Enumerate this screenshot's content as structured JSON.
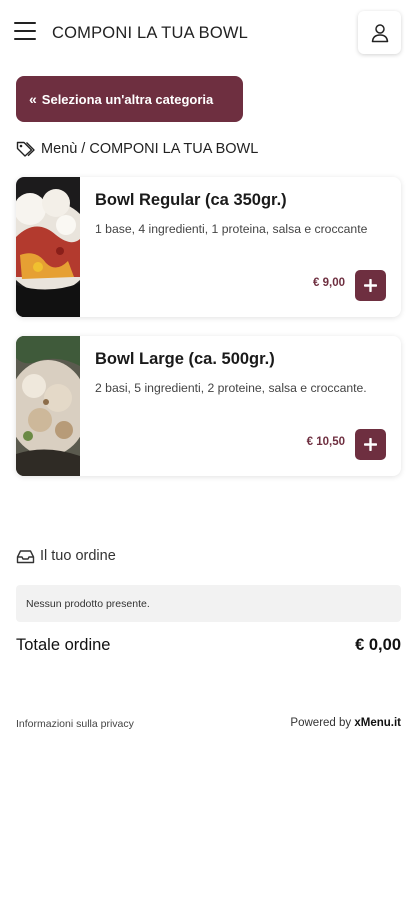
{
  "header": {
    "title": "COMPONI LA TUA BOWL",
    "menu_icon": "hamburger-menu-icon",
    "user_icon": "user-icon"
  },
  "back_button": {
    "chevron": "«",
    "label": "Seleziona un'altra categoria"
  },
  "breadcrumb": {
    "icon": "tags-icon",
    "text": "Menù / COMPONI LA TUA BOWL"
  },
  "products": [
    {
      "name": "Bowl Regular (ca 350gr.)",
      "description": "1 base, 4 ingredienti, 1 proteina, salsa e croccante",
      "price": "€ 9,00",
      "add_label": "+"
    },
    {
      "name": "Bowl Large (ca. 500gr.)",
      "description": "2 basi, 5 ingredienti, 2 proteine, salsa e croccante.",
      "price": "€ 10,50",
      "add_label": "+"
    }
  ],
  "order": {
    "icon": "inbox-icon",
    "title": "Il tuo ordine",
    "empty_text": "Nessun prodotto presente.",
    "total_label": "Totale ordine",
    "total_value": "€ 0,00"
  },
  "footer": {
    "privacy": "Informazioni sulla privacy",
    "powered_prefix": "Powered by",
    "powered_brand": "xMenu.it"
  },
  "colors": {
    "accent": "#6e2f40",
    "empty_box": "#f2f2f2"
  }
}
